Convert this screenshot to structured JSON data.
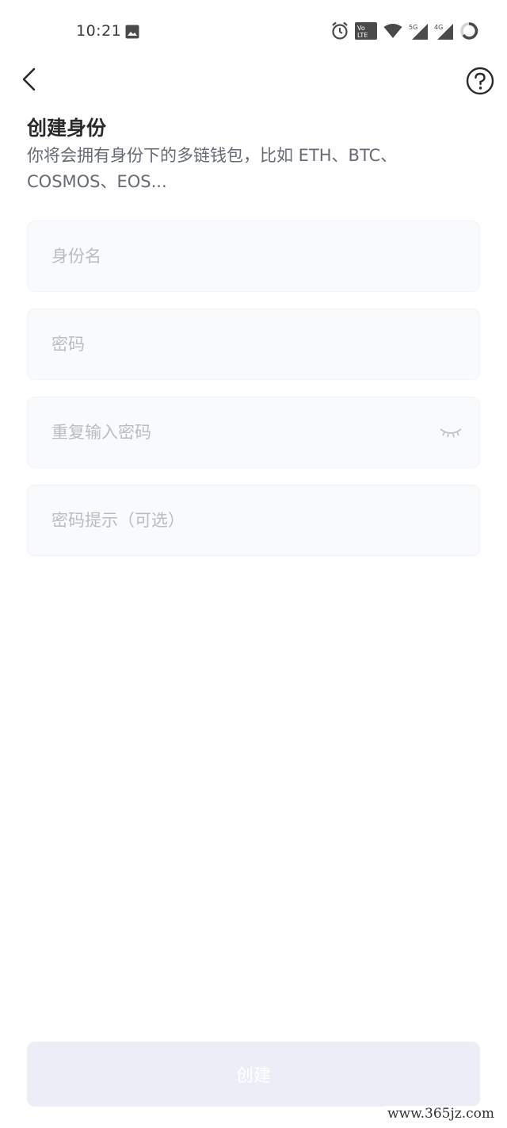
{
  "status_bar": {
    "time": "10:21",
    "icons": [
      "gallery-icon",
      "alarm-icon",
      "volte-icon",
      "wifi-icon",
      "signal-5g-icon",
      "signal-4g-icon",
      "battery-icon"
    ],
    "badge_volte_top": "Vo",
    "badge_volte_bottom": "LTE",
    "signal_label_1": "5G",
    "signal_label_2": "4G"
  },
  "nav": {
    "back_icon": "chevron-left-icon",
    "help_icon": "question-circle-icon"
  },
  "header": {
    "title": "创建身份",
    "subtitle": "你将会拥有身份下的多链钱包，比如 ETH、BTC、COSMOS、EOS..."
  },
  "form": {
    "identity_name_placeholder": "身份名",
    "password_placeholder": "密码",
    "repeat_password_placeholder": "重复输入密码",
    "password_hint_placeholder": "密码提示（可选）",
    "eye_icon": "eye-closed-icon"
  },
  "actions": {
    "create_label": "创建"
  },
  "watermark": "www.365jz.com",
  "colors": {
    "field_bg": "#f9fafc",
    "button_bg": "#eceef7",
    "placeholder": "#b9bcc3"
  }
}
